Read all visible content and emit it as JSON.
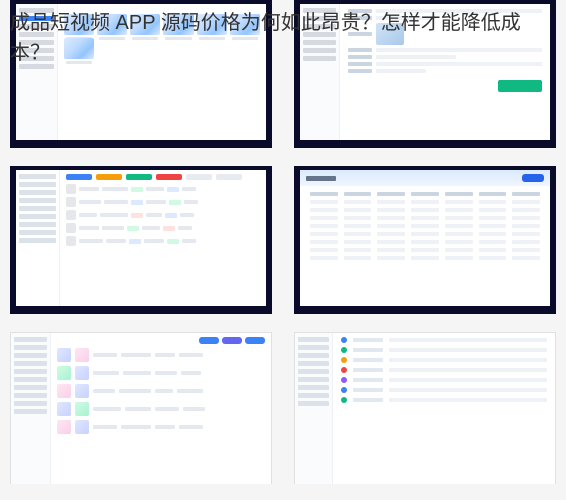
{
  "title": "成品短视频 APP 源码价格为何如此昂贵？怎样才能降低成本？",
  "thumbnails": {
    "row1": {
      "sidebar_items": 8,
      "thumb_count": 7
    },
    "row1_right": {
      "sidebar_items": 7,
      "button_color": "#10b981"
    },
    "row2_left": {
      "sidebar_items": 9,
      "tabs": [
        "蓝",
        "橙",
        "绿",
        "红"
      ],
      "tag_colors": [
        "green",
        "blue",
        "red"
      ]
    },
    "row2_right": {
      "header_gradient": [
        "#dbeafe",
        "#eff6ff"
      ],
      "button_color": "#2563eb",
      "columns": 7,
      "rows": 8
    },
    "row3_left": {
      "sidebar_items": 10,
      "pill_colors": [
        "#3b82f6",
        "#6366f1"
      ],
      "rows": 5
    },
    "row3_right": {
      "sidebar_items": 9,
      "dot_colors": [
        "blue",
        "green",
        "orange",
        "red",
        "purple"
      ],
      "rows": 7
    }
  }
}
